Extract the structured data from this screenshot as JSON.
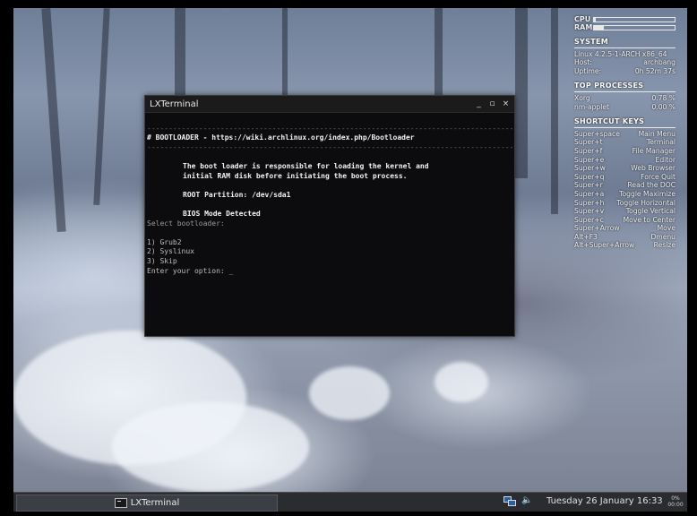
{
  "terminal": {
    "title": "LXTerminal",
    "controls": [
      "_",
      "▫",
      "×"
    ],
    "rule": "----------------------------------------------------------------------------------------------",
    "heading_prefix": "# ",
    "heading": "BOOTLOADER - https://wiki.archlinux.org/index.php/Bootloader",
    "desc_line1": "The boot loader is responsible for loading the kernel and",
    "desc_line2": "initial RAM disk before initiating the boot process.",
    "root_partition": "ROOT Partition: /dev/sda1",
    "bios_mode": "BIOS Mode Detected",
    "select_prompt": "Select bootloader:",
    "options": [
      "1) Grub2",
      "2) Syslinux",
      "3) Skip"
    ],
    "input_prompt": "Enter your option: _"
  },
  "conky": {
    "cpu_label": "CPU",
    "cpu_fraction": 0.02,
    "ram_label": "RAM",
    "ram_fraction": 0.12,
    "system": {
      "heading": "SYSTEM",
      "kernel": "Linux 4.2.5-1-ARCH  x86_64",
      "host_label": "Host:",
      "host_value": "archbang",
      "uptime_label": "Uptime:",
      "uptime_value": "0h 52m 37s"
    },
    "top_processes": {
      "heading": "TOP PROCESSES",
      "items": [
        {
          "name": "Xorg",
          "value": "0.78 %"
        },
        {
          "name": "nm-applet",
          "value": "0.00 %"
        }
      ]
    },
    "shortcuts": {
      "heading": "SHORTCUT KEYS",
      "items": [
        {
          "key": "Super+space",
          "action": "Main Menu"
        },
        {
          "key": "Super+t",
          "action": "Terminal"
        },
        {
          "key": "Super+f",
          "action": "File Manager"
        },
        {
          "key": "Super+e",
          "action": "Editor"
        },
        {
          "key": "Super+w",
          "action": "Web Browser"
        },
        {
          "key": "Super+q",
          "action": "Force Quit"
        },
        {
          "key": "Super+r",
          "action": "Read the DOC"
        },
        {
          "key": "Super+a",
          "action": "Toggle Maximize"
        },
        {
          "key": "Super+h",
          "action": "Toggle Horizontal"
        },
        {
          "key": "Super+v",
          "action": "Toggle Vertical"
        },
        {
          "key": "Super+c",
          "action": "Move to Center"
        },
        {
          "key": "Super+Arrow",
          "action": "Move"
        },
        {
          "key": "Alt+F3",
          "action": "Dmenu"
        },
        {
          "key": "Alt+Super+Arrow",
          "action": "Resize"
        }
      ]
    }
  },
  "taskbar": {
    "task_label": "LXTerminal",
    "clock": "Tuesday 26 January 16:33",
    "battery_percent": "0%",
    "battery_time": "00:00",
    "icons": {
      "task": "terminal-icon",
      "network": "network-icon",
      "volume": "volume-icon",
      "battery": "battery-icon"
    }
  }
}
